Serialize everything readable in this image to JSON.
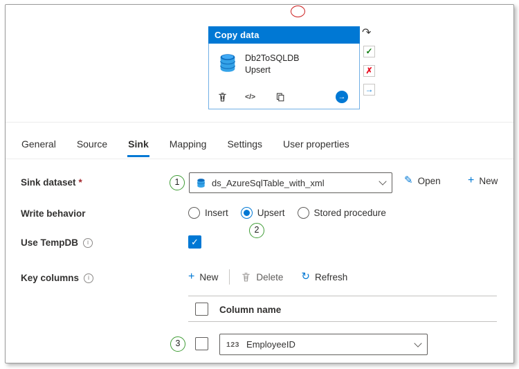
{
  "annotations": {
    "steps": [
      "1",
      "2",
      "3"
    ]
  },
  "icons": {
    "check": "✓",
    "cross": "✗",
    "arrow_right": "→",
    "redo": "↷",
    "plus": "+",
    "pencil": "✎",
    "refresh": "↻",
    "info": "i",
    "code": "</>"
  },
  "activity_card": {
    "title": "Copy data",
    "name": "Db2ToSQLDB",
    "mode": "Upsert"
  },
  "tabs": [
    {
      "label": "General",
      "active": false
    },
    {
      "label": "Source",
      "active": false
    },
    {
      "label": "Sink",
      "active": true
    },
    {
      "label": "Mapping",
      "active": false
    },
    {
      "label": "Settings",
      "active": false
    },
    {
      "label": "User properties",
      "active": false
    }
  ],
  "form": {
    "sink_dataset": {
      "label": "Sink dataset",
      "required_mark": "*",
      "value": "ds_AzureSqlTable_with_xml",
      "open_label": "Open",
      "new_label": "New"
    },
    "write_behavior": {
      "label": "Write behavior",
      "options": [
        {
          "label": "Insert",
          "selected": false
        },
        {
          "label": "Upsert",
          "selected": true
        },
        {
          "label": "Stored procedure",
          "selected": false
        }
      ]
    },
    "use_tempdb": {
      "label": "Use TempDB",
      "checked": true
    },
    "key_columns": {
      "label": "Key columns",
      "toolbar": {
        "new_label": "New",
        "delete_label": "Delete",
        "refresh_label": "Refresh"
      },
      "table": {
        "header": "Column name",
        "rows": [
          {
            "type_badge": "123",
            "value": "EmployeeID"
          }
        ]
      }
    }
  },
  "colors": {
    "accent": "#0078d4",
    "annotation_green": "#3f9c35",
    "annotation_red": "#cc2020",
    "success_green": "#107c10",
    "error_red": "#e81123"
  }
}
